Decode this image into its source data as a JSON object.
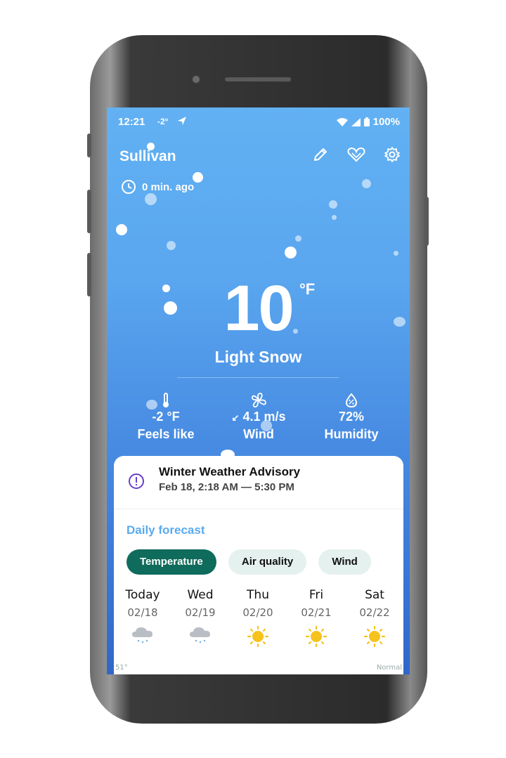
{
  "status_bar": {
    "time": "12:21",
    "temp": "-2°",
    "battery": "100%"
  },
  "header": {
    "city": "Sullivan",
    "updated": "0 min. ago"
  },
  "icons": {
    "edit": "pencil-icon",
    "favorite": "heart-icon",
    "settings": "gear-icon",
    "clock": "clock-icon"
  },
  "current": {
    "temp": "10",
    "unit": "°F",
    "condition": "Light Snow"
  },
  "metrics": [
    {
      "value": "-2 °F",
      "label": "Feels like",
      "icon": "thermometer-icon"
    },
    {
      "value": "4.1 m/s",
      "label": "Wind",
      "icon": "fan-icon"
    },
    {
      "value": "72%",
      "label": "Humidity",
      "icon": "humidity-icon"
    }
  ],
  "advisory": {
    "title": "Winter Weather Advisory",
    "time": "Feb 18, 2:18 AM — 5:30 PM",
    "icon": "alert-circle-icon"
  },
  "daily": {
    "title": "Daily forecast",
    "chips": [
      "Temperature",
      "Air quality",
      "Wind"
    ],
    "active_chip": "Temperature",
    "days": [
      {
        "name": "Today",
        "date": "02/18",
        "icon": "snow-cloud-icon"
      },
      {
        "name": "Wed",
        "date": "02/19",
        "icon": "snow-cloud-icon"
      },
      {
        "name": "Thu",
        "date": "02/20",
        "icon": "sun-icon"
      },
      {
        "name": "Fri",
        "date": "02/21",
        "icon": "sun-icon"
      },
      {
        "name": "Sat",
        "date": "02/22",
        "icon": "sun-icon"
      }
    ],
    "footer_left": "51°",
    "footer_right": "Normal"
  },
  "colors": {
    "accent": "#0f6b5c",
    "chip_bg": "#e5f1ee",
    "daily_title": "#5aaaf0",
    "advisory_icon": "#6a3fc8",
    "sun": "#f6c21c"
  }
}
